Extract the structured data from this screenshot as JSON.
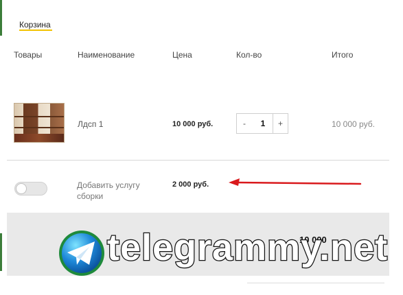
{
  "tabs": {
    "cart": "Корзина"
  },
  "table": {
    "headers": {
      "goods": "Товары",
      "name": "Наименование",
      "price": "Цена",
      "qty": "Кол-во",
      "total": "Итого"
    },
    "row": {
      "name": "Лдсп 1",
      "price": "10 000 руб.",
      "qty_minus": "-",
      "qty_value": "1",
      "qty_plus": "+",
      "total": "10 000 руб."
    },
    "service": {
      "label": "Добавить услугу сборки",
      "price": "2 000 руб.",
      "enabled": false
    }
  },
  "summary": {
    "total_value": "10 000"
  },
  "watermark": {
    "text": "telegrammy.net",
    "icon": "telegram-logo"
  },
  "colors": {
    "accent": "#f2c200",
    "arrow": "#d9191c",
    "sidebar": "#3c7d3a",
    "summary_bg": "#e9e9e9"
  }
}
